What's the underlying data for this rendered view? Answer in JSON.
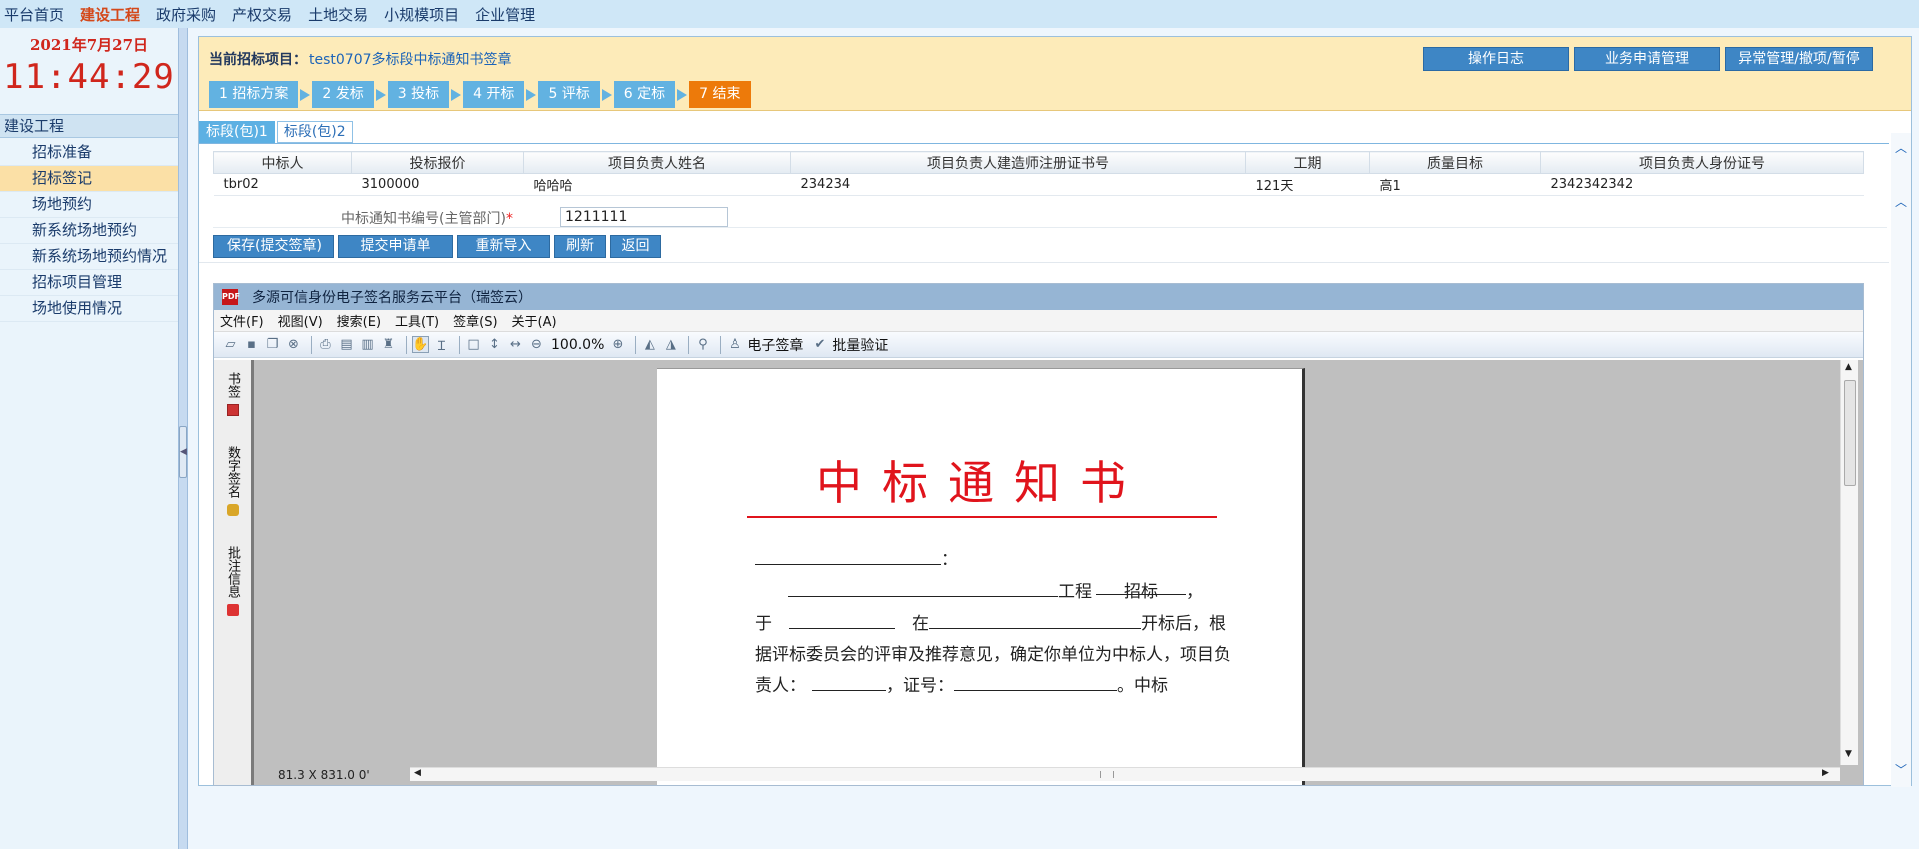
{
  "topnav": [
    {
      "label": "平台首页",
      "active": false
    },
    {
      "label": "建设工程",
      "active": true
    },
    {
      "label": "政府采购",
      "active": false
    },
    {
      "label": "产权交易",
      "active": false
    },
    {
      "label": "土地交易",
      "active": false
    },
    {
      "label": "小规模项目",
      "active": false
    },
    {
      "label": "企业管理",
      "active": false
    }
  ],
  "sidebar": {
    "date": "2021年7月27日",
    "time": "11:44:29",
    "title": "建设工程",
    "items": [
      {
        "label": "招标准备",
        "active": false
      },
      {
        "label": "招标签记",
        "active": true
      },
      {
        "label": "场地预约",
        "active": false
      },
      {
        "label": "新系统场地预约",
        "active": false
      },
      {
        "label": "新系统场地预约情况",
        "active": false
      },
      {
        "label": "招标项目管理",
        "active": false
      },
      {
        "label": "场地使用情况",
        "active": false
      }
    ]
  },
  "header": {
    "project_label": "当前招标项目：",
    "project_name": "test0707多标段中标通知书签章",
    "buttons": [
      "操作日志",
      "业务申请管理",
      "异常管理/撤项/暂停"
    ],
    "steps": [
      {
        "label": "1 招标方案",
        "active": false
      },
      {
        "label": "2 发标",
        "active": false
      },
      {
        "label": "3 投标",
        "active": false
      },
      {
        "label": "4 开标",
        "active": false
      },
      {
        "label": "5 评标",
        "active": false
      },
      {
        "label": "6 定标",
        "active": false
      },
      {
        "label": "7 结束",
        "active": true
      }
    ]
  },
  "tabs": [
    {
      "label": "标段(包)1",
      "active": true
    },
    {
      "label": "标段(包)2",
      "active": false
    }
  ],
  "table": {
    "columns": [
      "中标人",
      "投标报价",
      "项目负责人姓名",
      "项目负责人建造师注册证书号",
      "工期",
      "质量目标",
      "项目负责人身份证号"
    ],
    "rows": [
      [
        "tbr02",
        "3100000",
        "哈哈哈",
        "234234",
        "121天",
        "高1",
        "2342342342"
      ]
    ]
  },
  "notice": {
    "label": "中标通知书编号(主管部门)",
    "required_mark": "*",
    "value": "1211111"
  },
  "actions": [
    "保存(提交签章)",
    "提交申请单",
    "重新导入",
    "刷新",
    "返回"
  ],
  "viewer": {
    "title": "多源可信身份电子签名服务云平台（瑞签云）",
    "menu": [
      "文件(F)",
      "视图(V)",
      "搜索(E)",
      "工具(T)",
      "签章(S)",
      "关于(A)"
    ],
    "zoom": "100.0%",
    "esign_label": "电子签章",
    "verify_label": "批量验证",
    "side_tabs": [
      "书签",
      "数字签名",
      "批注信息"
    ],
    "status": "81.3 X 831.0 0'"
  },
  "document": {
    "title": "中标通知书",
    "colon": "：",
    "line1_project": "工程",
    "line1_bid": "招标",
    "line1_end": "，",
    "line2_start": "于",
    "line2_mid": "在",
    "line2_end": "开标后，根",
    "line3": "据评标委员会的评审及推荐意见，确定你单位为中标人，项目负",
    "line4_start": "责人：",
    "line4_mid": "，证号：",
    "line4_end": "。中标"
  },
  "colors": {
    "accent": "#3e86c5",
    "step": "#62b2e1",
    "step_active": "#ed7a0a",
    "header_bg": "#fdebb9",
    "doc_red": "#e0141c",
    "clock_red": "#d0261c"
  }
}
